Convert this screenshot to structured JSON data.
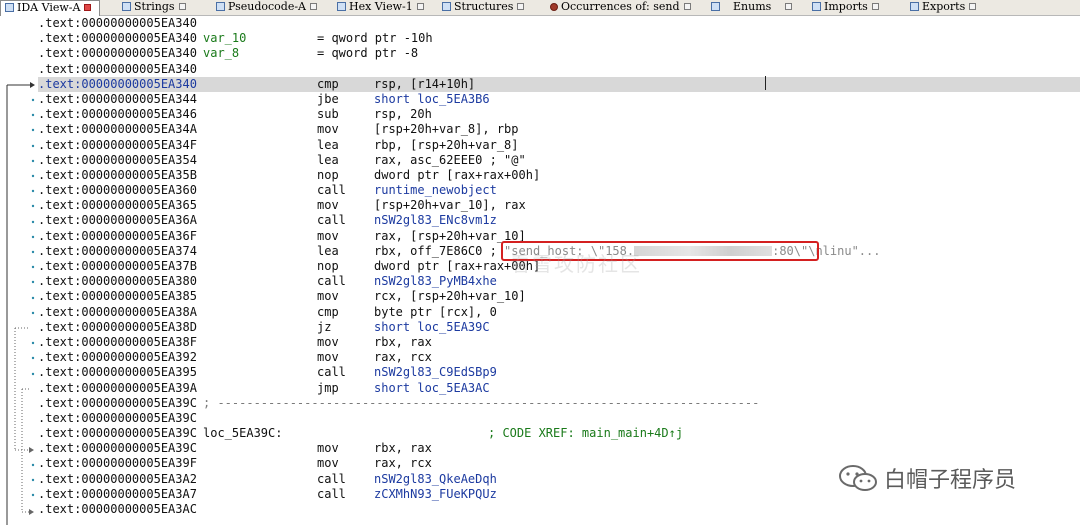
{
  "tabs": [
    {
      "label": "IDA View-A",
      "active": true
    },
    {
      "label": "Strings",
      "active": false
    },
    {
      "label": "Pseudocode-A",
      "active": false
    },
    {
      "label": "Hex View-1",
      "active": false
    },
    {
      "label": "Structures",
      "active": false
    },
    {
      "label": "Occurrences of: send",
      "active": false
    },
    {
      "label": "Enums",
      "active": false
    },
    {
      "label": "Imports",
      "active": false
    },
    {
      "label": "Exports",
      "active": false
    }
  ],
  "listing": {
    "rows": [
      {
        "addr": ".text:00000000005EA340"
      },
      {
        "addr": ".text:00000000005EA340",
        "label": "var_10",
        "mnem": "= qword ptr -10h"
      },
      {
        "addr": ".text:00000000005EA340",
        "label": "var_8",
        "mnem": "= qword ptr -8"
      },
      {
        "addr": ".text:00000000005EA340"
      },
      {
        "addr": ".text:00000000005EA340",
        "mnem": "cmp",
        "ops": "rsp, [r14+10h]"
      },
      {
        "addr": ".text:00000000005EA344",
        "mnem": "jbe",
        "ops": "short loc_5EA3B6"
      },
      {
        "addr": ".text:00000000005EA346",
        "mnem": "sub",
        "ops": "rsp, 20h"
      },
      {
        "addr": ".text:00000000005EA34A",
        "mnem": "mov",
        "ops": "[rsp+20h+var_8], rbp"
      },
      {
        "addr": ".text:00000000005EA34F",
        "mnem": "lea",
        "ops": "rbp, [rsp+20h+var_8]"
      },
      {
        "addr": ".text:00000000005EA354",
        "mnem": "lea",
        "ops": "rax, asc_62EEE0 ; \"@\""
      },
      {
        "addr": ".text:00000000005EA35B",
        "mnem": "nop",
        "ops": "dword ptr [rax+rax+00h]"
      },
      {
        "addr": ".text:00000000005EA360",
        "mnem": "call",
        "ops": "runtime_newobject"
      },
      {
        "addr": ".text:00000000005EA365",
        "mnem": "mov",
        "ops": "[rsp+20h+var_10], rax"
      },
      {
        "addr": ".text:00000000005EA36A",
        "mnem": "call",
        "ops": "nSW2gl83_ENc8vm1z"
      },
      {
        "addr": ".text:00000000005EA36F",
        "mnem": "mov",
        "ops": "rax, [rsp+20h+var_10]"
      },
      {
        "addr": ".text:00000000005EA374",
        "mnem": "lea",
        "ops": "rbx, off_7E86C0 ; "
      },
      {
        "addr": ".text:00000000005EA37B",
        "mnem": "nop",
        "ops": "dword ptr [rax+rax+00h]"
      },
      {
        "addr": ".text:00000000005EA380",
        "mnem": "call",
        "ops": "nSW2gl83_PyMB4xhe"
      },
      {
        "addr": ".text:00000000005EA385",
        "mnem": "mov",
        "ops": "rcx, [rsp+20h+var_10]"
      },
      {
        "addr": ".text:00000000005EA38A",
        "mnem": "cmp",
        "ops": "byte ptr [rcx], 0"
      },
      {
        "addr": ".text:00000000005EA38D",
        "mnem": "jz",
        "ops": "short loc_5EA39C"
      },
      {
        "addr": ".text:00000000005EA38F",
        "mnem": "mov",
        "ops": "rbx, rax"
      },
      {
        "addr": ".text:00000000005EA392",
        "mnem": "mov",
        "ops": "rax, rcx"
      },
      {
        "addr": ".text:00000000005EA395",
        "mnem": "call",
        "ops": "nSW2gl83_C9EdSBp9"
      },
      {
        "addr": ".text:00000000005EA39A",
        "mnem": "jmp",
        "ops": "short loc_5EA3AC"
      },
      {
        "addr": ".text:00000000005EA39C",
        "label": "; ---------------------------------------------------------------------------"
      },
      {
        "addr": ".text:00000000005EA39C"
      },
      {
        "addr": ".text:00000000005EA39C",
        "label": "loc_5EA39C:",
        "xref": "; CODE XREF: main_main+4D↑j"
      },
      {
        "addr": ".text:00000000005EA39C",
        "mnem": "mov",
        "ops": "rbx, rax"
      },
      {
        "addr": ".text:00000000005EA39F",
        "mnem": "mov",
        "ops": "rax, rcx"
      },
      {
        "addr": ".text:00000000005EA3A2",
        "mnem": "call",
        "ops": "nSW2gl83_QkeAeDqh"
      },
      {
        "addr": ".text:00000000005EA3A7",
        "mnem": "call",
        "ops": "zCXMhN93_FUeKPQUz"
      },
      {
        "addr": ".text:00000000005EA3AC"
      }
    ],
    "highlight_string_start": "\"send_host: \\\"158.",
    "highlight_string_end": ":80\\\"\\nlinu\"..."
  },
  "watermark": {
    "center": "看雪攻防社区",
    "brand": "白帽子程序员"
  }
}
